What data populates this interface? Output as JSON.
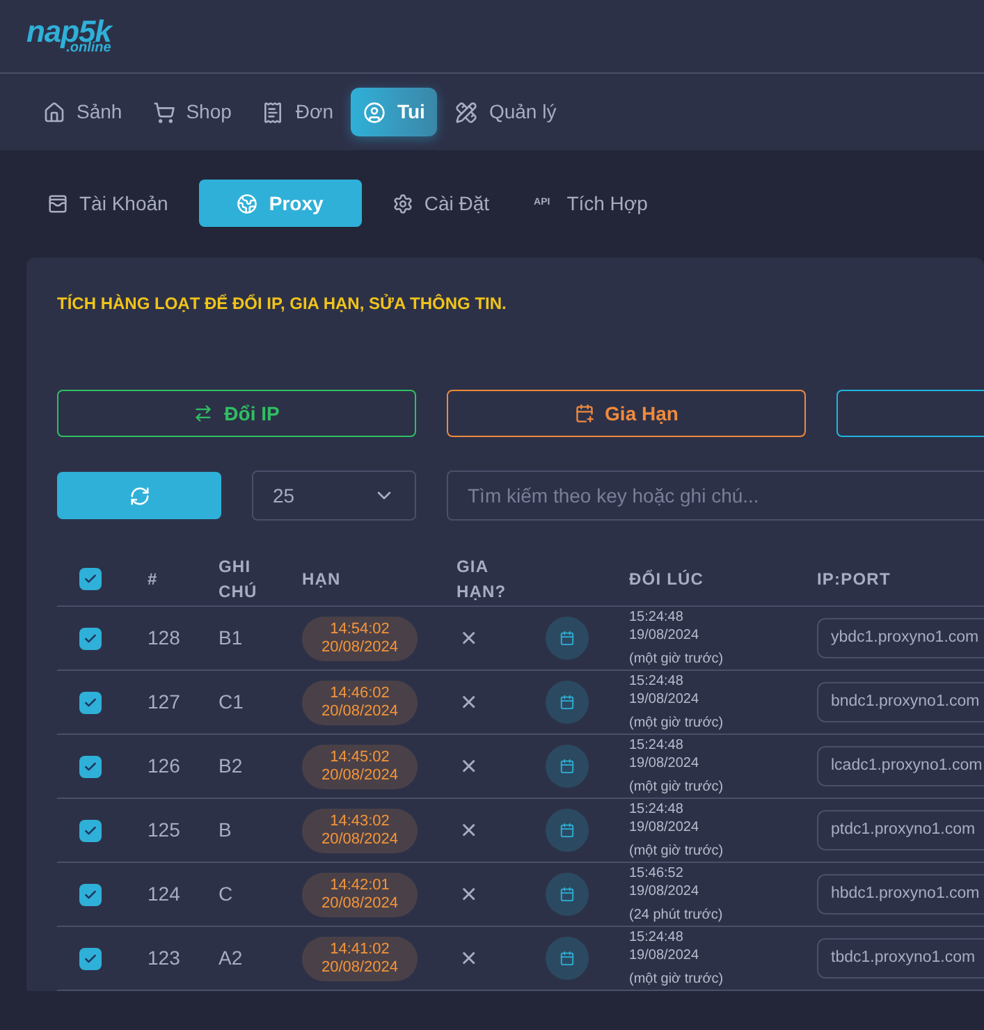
{
  "logo": {
    "main": "nap5k",
    "sub": ".online"
  },
  "nav": [
    {
      "label": "Sảnh",
      "kind": "home",
      "selected": false
    },
    {
      "label": "Shop",
      "kind": "cart",
      "selected": false
    },
    {
      "label": "Đơn",
      "kind": "receipt",
      "selected": false
    },
    {
      "label": "Tui",
      "kind": "user",
      "selected": true
    },
    {
      "label": "Quản lý",
      "kind": "tools",
      "selected": false
    }
  ],
  "subtabs": [
    {
      "label": "Tài Khoản",
      "kind": "wallet",
      "selected": false
    },
    {
      "label": "Proxy",
      "kind": "globe",
      "selected": true
    },
    {
      "label": "Cài Đặt",
      "kind": "gear",
      "selected": false
    },
    {
      "label": "Tích Hợp",
      "kind": "api",
      "icon_text": "API",
      "selected": false
    }
  ],
  "notice": "TÍCH HÀNG LOẠT ĐỂ ĐỔI IP, GIA HẠN, SỬA THÔNG TIN.",
  "actions": [
    {
      "label": "Đổi IP",
      "kind": "swap"
    },
    {
      "label": "Gia Hạn",
      "kind": "renew"
    },
    {
      "kind": "edit"
    }
  ],
  "page_size": "25",
  "search": {
    "placeholder": "Tìm kiếm theo key hoặc ghi chú..."
  },
  "table": {
    "select_all": {
      "checked": true
    },
    "columns": [
      "#",
      "GHI CHÚ",
      "HẠN",
      "GIA HẠN?",
      "ĐỔI LÚC",
      "IP:PORT"
    ],
    "rows": [
      {
        "checked": true,
        "id": "128",
        "note": "B1",
        "expiry_time": "14:54:02",
        "expiry_date": "20/08/2024",
        "renew": "×",
        "changed_time": "15:24:48",
        "changed_date": "19/08/2024",
        "changed_ago": "(một giờ trước)",
        "ip": "ybdc1.proxyno1.com"
      },
      {
        "checked": true,
        "id": "127",
        "note": "C1",
        "expiry_time": "14:46:02",
        "expiry_date": "20/08/2024",
        "renew": "×",
        "changed_time": "15:24:48",
        "changed_date": "19/08/2024",
        "changed_ago": "(một giờ trước)",
        "ip": "bndc1.proxyno1.com"
      },
      {
        "checked": true,
        "id": "126",
        "note": "B2",
        "expiry_time": "14:45:02",
        "expiry_date": "20/08/2024",
        "renew": "×",
        "changed_time": "15:24:48",
        "changed_date": "19/08/2024",
        "changed_ago": "(một giờ trước)",
        "ip": "lcadc1.proxyno1.com"
      },
      {
        "checked": true,
        "id": "125",
        "note": "B",
        "expiry_time": "14:43:02",
        "expiry_date": "20/08/2024",
        "renew": "×",
        "changed_time": "15:24:48",
        "changed_date": "19/08/2024",
        "changed_ago": "(một giờ trước)",
        "ip": "ptdc1.proxyno1.com"
      },
      {
        "checked": true,
        "id": "124",
        "note": "C",
        "expiry_time": "14:42:01",
        "expiry_date": "20/08/2024",
        "renew": "×",
        "changed_time": "15:46:52",
        "changed_date": "19/08/2024",
        "changed_ago": "(24 phút trước)",
        "ip": "hbdc1.proxyno1.com"
      },
      {
        "checked": true,
        "id": "123",
        "note": "A2",
        "expiry_time": "14:41:02",
        "expiry_date": "20/08/2024",
        "renew": "×",
        "changed_time": "15:24:48",
        "changed_date": "19/08/2024",
        "changed_ago": "(một giờ trước)",
        "ip": "tbdc1.proxyno1.com"
      }
    ]
  }
}
